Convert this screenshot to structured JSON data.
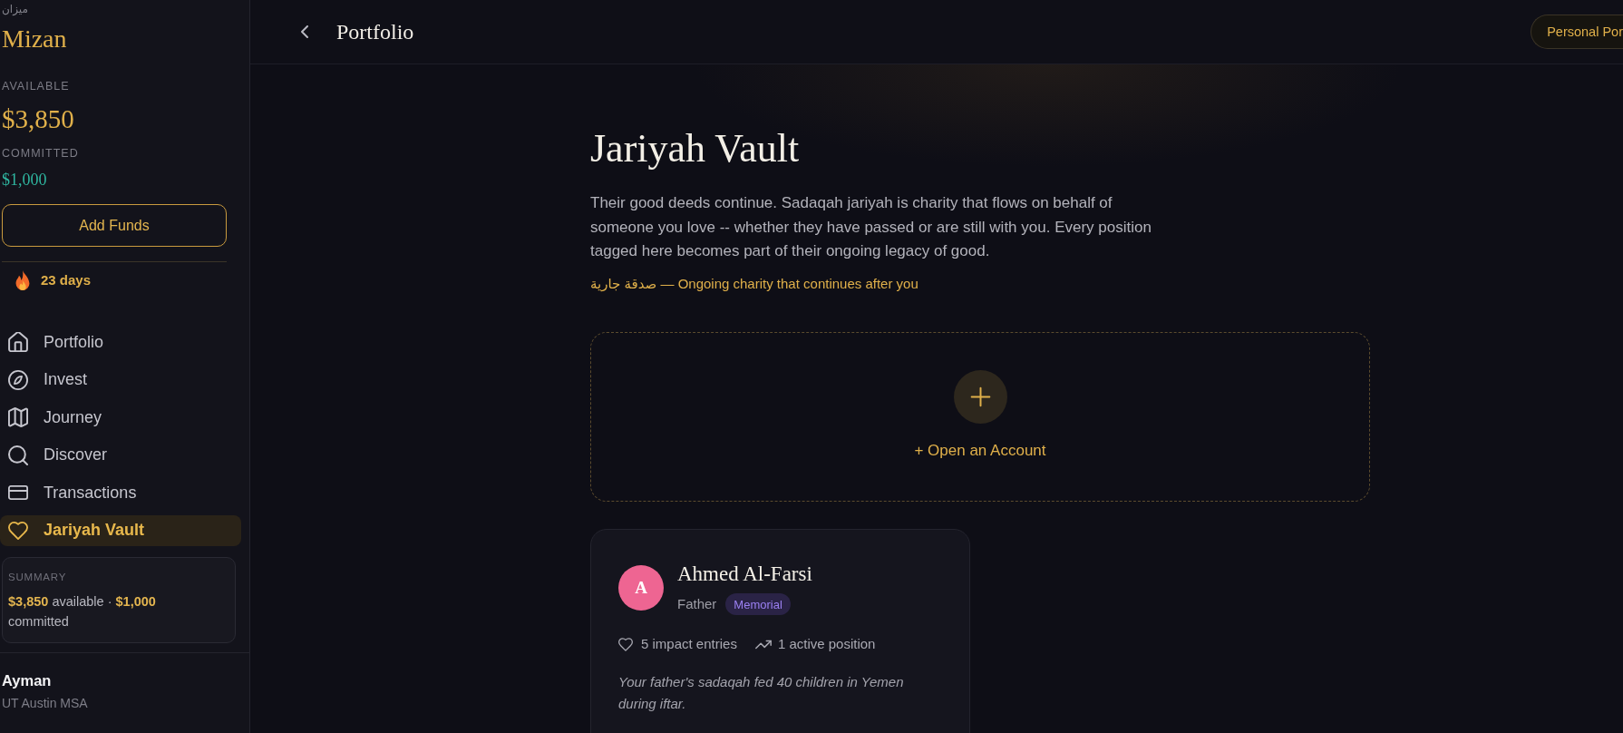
{
  "sidebar": {
    "brand": {
      "arabic": "ميزان",
      "name": "Mizan"
    },
    "balances": [
      {
        "kind": "available",
        "label": "AVAILABLE",
        "amount": "$3,850"
      },
      {
        "kind": "committed",
        "label": "COMMITTED",
        "amount": "$1,000"
      }
    ],
    "add_funds_button": "Add Funds",
    "streak": "23 days",
    "nav_items": [
      {
        "label": "Portfolio",
        "selected": false
      },
      {
        "label": "Invest",
        "selected": false
      },
      {
        "label": "Journey",
        "selected": false
      },
      {
        "label": "Discover",
        "selected": false
      },
      {
        "label": "Transactions",
        "selected": false
      },
      {
        "label": "Jariyah Vault",
        "selected": true
      }
    ],
    "summary": {
      "label": "SUMMARY",
      "text": "**$3,850** available · **$1,000** committed"
    },
    "user": {
      "name": "Ayman",
      "organization": "UT Austin MSA"
    }
  },
  "header": {
    "title": "Portfolio",
    "portfolio_menu_button": "Personal Por"
  },
  "vault": {
    "title": "Jariyah Vault",
    "description": "Their good deeds continue. Sadaqah jariyah is charity that flows on behalf of someone you love -- whether they have passed or are still with you. Every position tagged here becomes part of their ongoing legacy of good.",
    "subtitle": "صدقة جارية — Ongoing charity that continues after you",
    "open_account_button": "+ Open an Account",
    "people": [
      {
        "initial": "A",
        "color": "#ee6592",
        "name": "Ahmed Al-Farsi",
        "relation": "Father",
        "tag": "Memorial",
        "impact_entries": "5 impact entries",
        "active_positions": "1 active position",
        "note": "Your father's sadaqah fed 40 children in Yemen during iftar."
      }
    ]
  }
}
